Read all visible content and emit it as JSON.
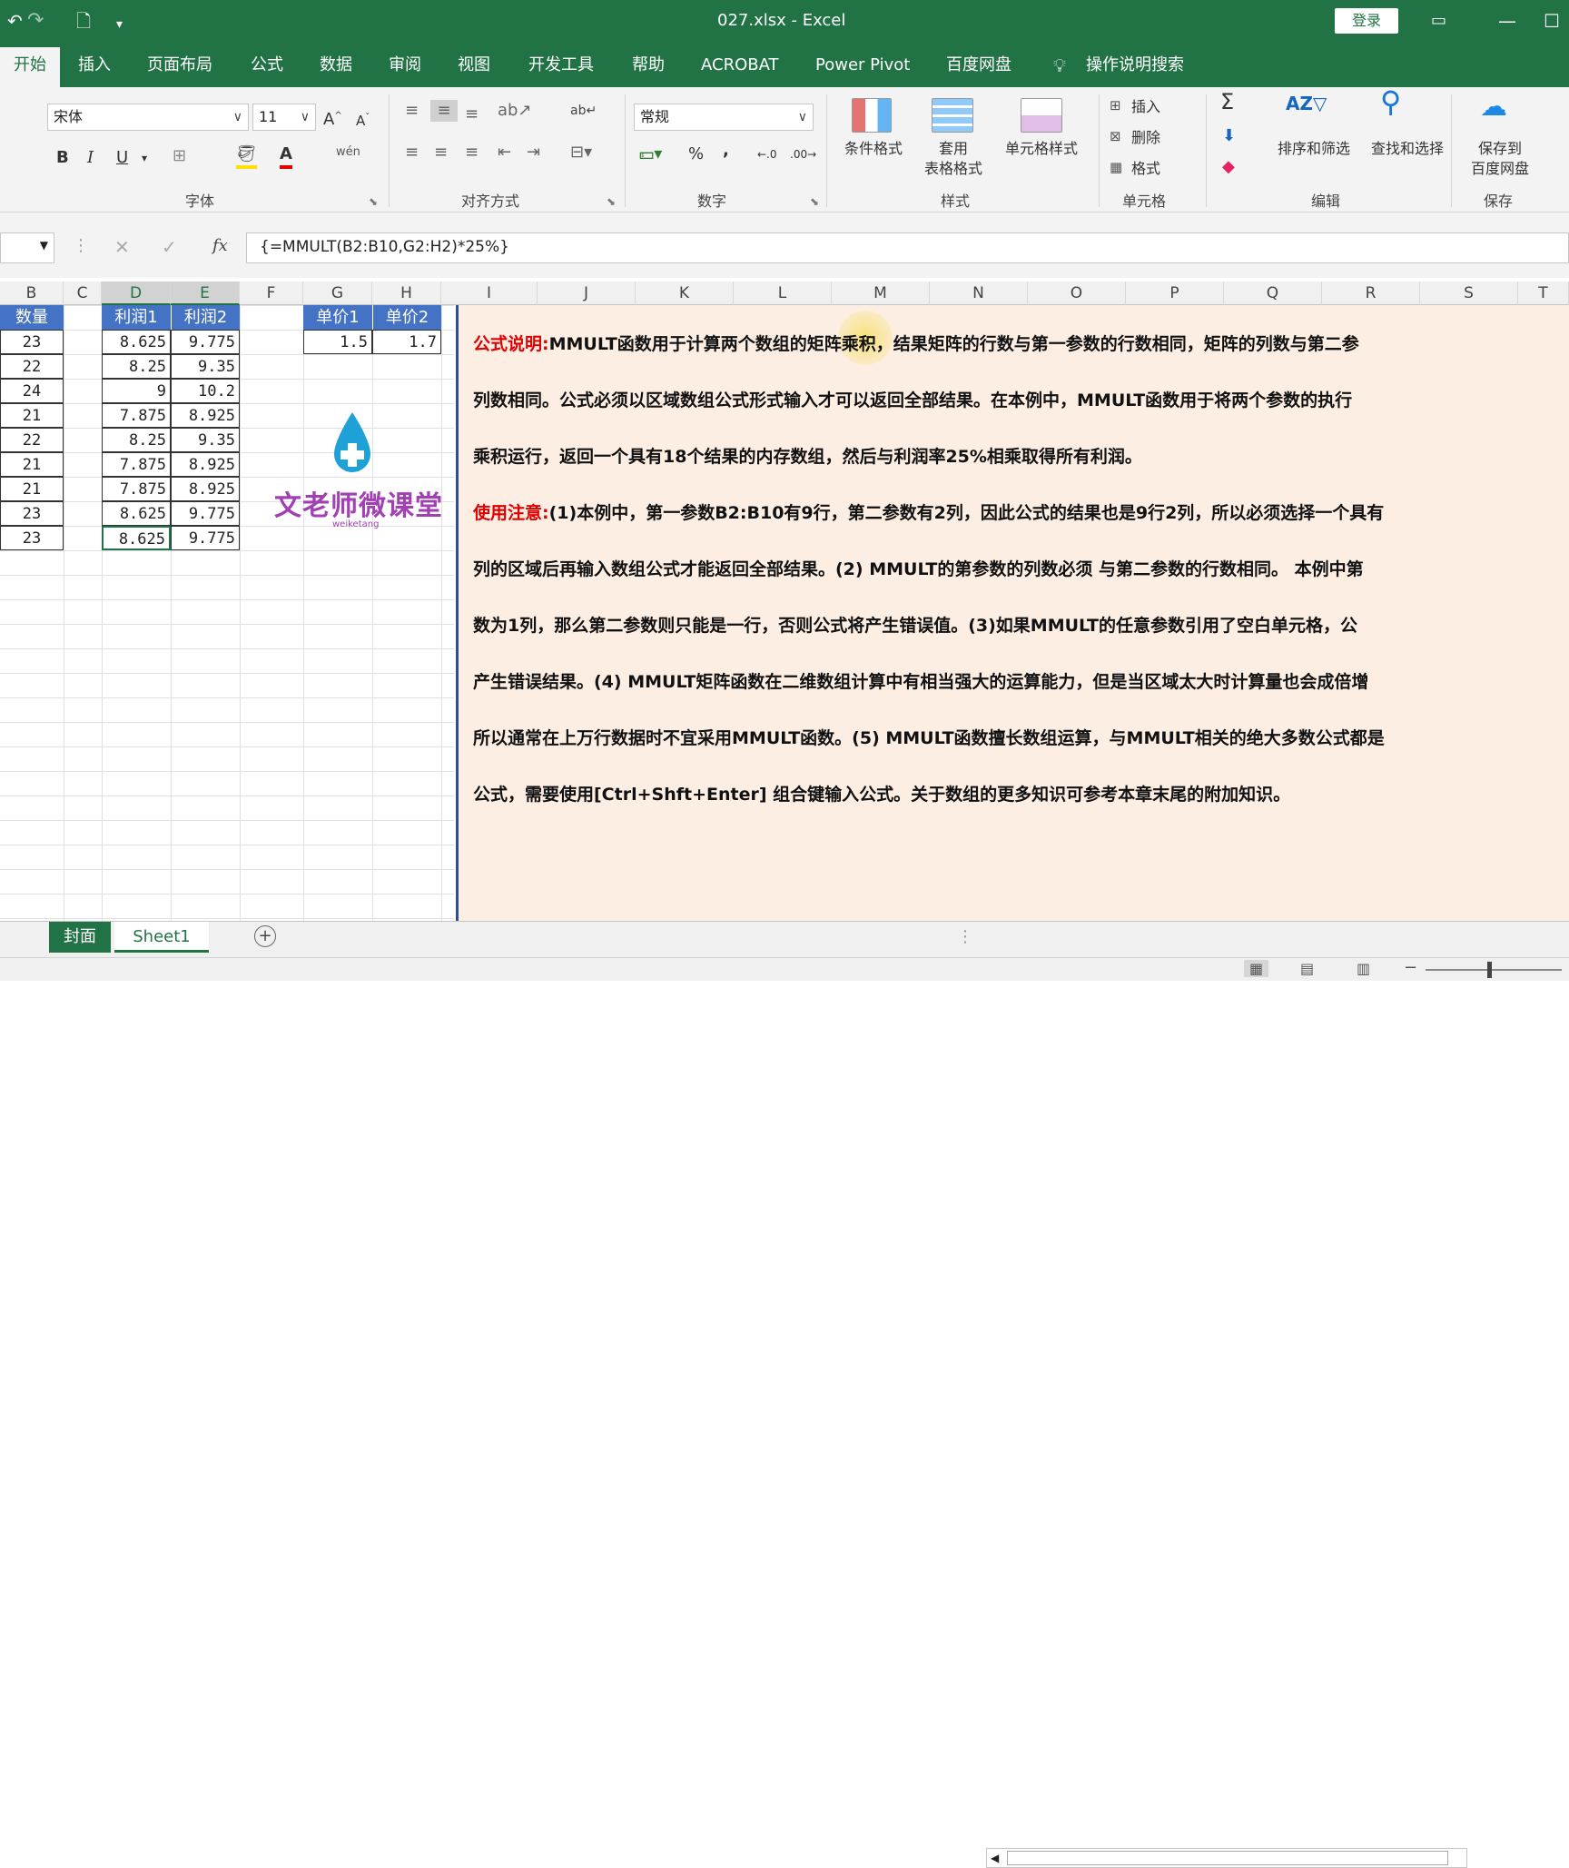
{
  "window": {
    "title": "027.xlsx  -  Excel",
    "login": "登录"
  },
  "tabs": [
    "开始",
    "插入",
    "页面布局",
    "公式",
    "数据",
    "审阅",
    "视图",
    "开发工具",
    "帮助",
    "ACROBAT",
    "Power Pivot",
    "百度网盘",
    "操作说明搜索"
  ],
  "ribbon": {
    "font_name": "宋体",
    "font_size": "11",
    "number_format": "常规",
    "groups": {
      "font": "字体",
      "align": "对齐方式",
      "number": "数字",
      "styles": "样式",
      "cells": "单元格",
      "edit": "编辑",
      "save": "保存"
    },
    "buttons": {
      "cond_format": "条件格式",
      "table_format_1": "套用",
      "table_format_2": "表格格式",
      "cell_style": "单元格样式",
      "insert": "插入",
      "delete": "删除",
      "format": "格式",
      "sort_filter": "排序和筛选",
      "find_select": "查找和选择",
      "save_cloud_1": "保存到",
      "save_cloud_2": "百度网盘",
      "bold": "B",
      "italic": "I",
      "underline": "U",
      "wen": "wén",
      "percent": "%",
      "comma": ","
    }
  },
  "formula": "{=MMULT(B2:B10,G2:H2)*25%}",
  "columns": [
    "B",
    "C",
    "D",
    "E",
    "F",
    "G",
    "H",
    "I",
    "J",
    "K",
    "L",
    "M",
    "N",
    "O",
    "P",
    "Q",
    "R",
    "S",
    "T"
  ],
  "table": {
    "header_qty": "数量",
    "header_p1": "利润1",
    "header_p2": "利润2",
    "qty": [
      "23",
      "22",
      "24",
      "21",
      "22",
      "21",
      "21",
      "23",
      "23"
    ],
    "p1": [
      "8.625",
      "8.25",
      "9",
      "7.875",
      "8.25",
      "7.875",
      "7.875",
      "8.625",
      "8.625"
    ],
    "p2": [
      "9.775",
      "9.35",
      "10.2",
      "8.925",
      "9.35",
      "8.925",
      "8.925",
      "9.775",
      "9.775"
    ]
  },
  "price": {
    "h1": "单价1",
    "h2": "单价2",
    "v1": "1.5",
    "v2": "1.7"
  },
  "logo": {
    "text": "文老师微课堂",
    "sub": "weiketang"
  },
  "notes": {
    "l1_red": "公式说明:",
    "l1": "MMULT函数用于计算两个数组的矩阵乘积，结果矩阵的行数与第一参数的行数相同，矩阵的列数与第二参",
    "l2": "列数相同。公式必须以区域数组公式形式输入才可以返回全部结果。在本例中，MMULT函数用于将两个参数的执行",
    "l3": "乘积运行，返回一个具有18个结果的内存数组，然后与利润率25%相乘取得所有利润。",
    "l4_red": "使用注意:",
    "l4": "(1)本例中，第一参数B2:B10有9行，第二参数有2列，因此公式的结果也是9行2列，所以必须选择一个具有",
    "l5": "列的区域后再输入数组公式才能返回全部结果。(2) MMULT的第参数的列数必须 与第二参数的行数相同。 本例中第",
    "l6": "数为1列，那么第二参数则只能是一行，否则公式将产生错误值。(3)如果MMULT的任意参数引用了空白单元格，公",
    "l7": "产生错误结果。(4) MMULT矩阵函数在二维数组计算中有相当强大的运算能力，但是当区域太大时计算量也会成倍增",
    "l8": "所以通常在上万行数据时不宜采用MMULT函数。(5) MMULT函数擅长数组运算，与MMULT相关的绝大多数公式都是",
    "l9": "公式，需要使用[Ctrl+Shft+Enter] 组合键输入公式。关于数组的更多知识可参考本章末尾的附加知识。"
  },
  "sheets": [
    "封面",
    "Sheet1"
  ],
  "colors": {
    "excel_green": "#217346",
    "header_blue": "#4472c4",
    "note_bg": "#fdeee4",
    "red": "#e00000"
  }
}
